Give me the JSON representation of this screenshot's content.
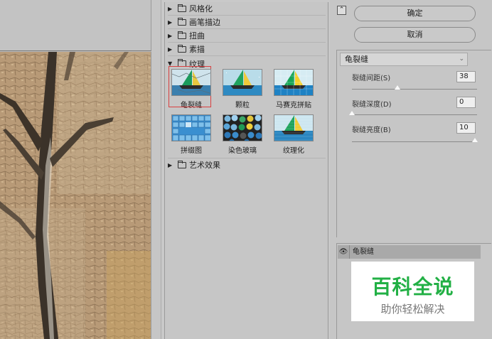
{
  "gallery": {
    "categories": [
      {
        "label": "风格化",
        "expanded": false
      },
      {
        "label": "画笔描边",
        "expanded": false
      },
      {
        "label": "扭曲",
        "expanded": false
      },
      {
        "label": "素描",
        "expanded": false
      },
      {
        "label": "纹理",
        "expanded": true
      },
      {
        "label": "艺术效果",
        "expanded": false
      }
    ],
    "texture_filters": [
      {
        "label": "龟裂缝",
        "selected": true,
        "icon": "sailboat-thumbnail"
      },
      {
        "label": "颗粒",
        "selected": false,
        "icon": "sailboat-thumbnail"
      },
      {
        "label": "马赛克拼贴",
        "selected": false,
        "icon": "sailboat-thumbnail"
      },
      {
        "label": "拼缀图",
        "selected": false,
        "icon": "patchwork-thumbnail"
      },
      {
        "label": "染色玻璃",
        "selected": false,
        "icon": "stained-glass-thumbnail"
      },
      {
        "label": "纹理化",
        "selected": false,
        "icon": "sailboat-thumbnail"
      }
    ]
  },
  "buttons": {
    "ok": "确定",
    "cancel": "取消"
  },
  "settings": {
    "filter_select": "龟裂缝",
    "params": [
      {
        "label": "裂缝间距(S)",
        "value": "38",
        "fraction": 0.38
      },
      {
        "label": "裂缝深度(D)",
        "value": "0",
        "fraction": 0.0
      },
      {
        "label": "裂缝亮度(B)",
        "value": "10",
        "fraction": 1.0
      }
    ]
  },
  "layers": {
    "items": [
      {
        "name": "龟裂缝",
        "visible": true
      }
    ]
  },
  "watermark": {
    "title": "百科全说",
    "subtitle": "助你轻松解决"
  },
  "colors": {
    "accent_selection": "#d94040",
    "watermark_green": "#22b045"
  }
}
